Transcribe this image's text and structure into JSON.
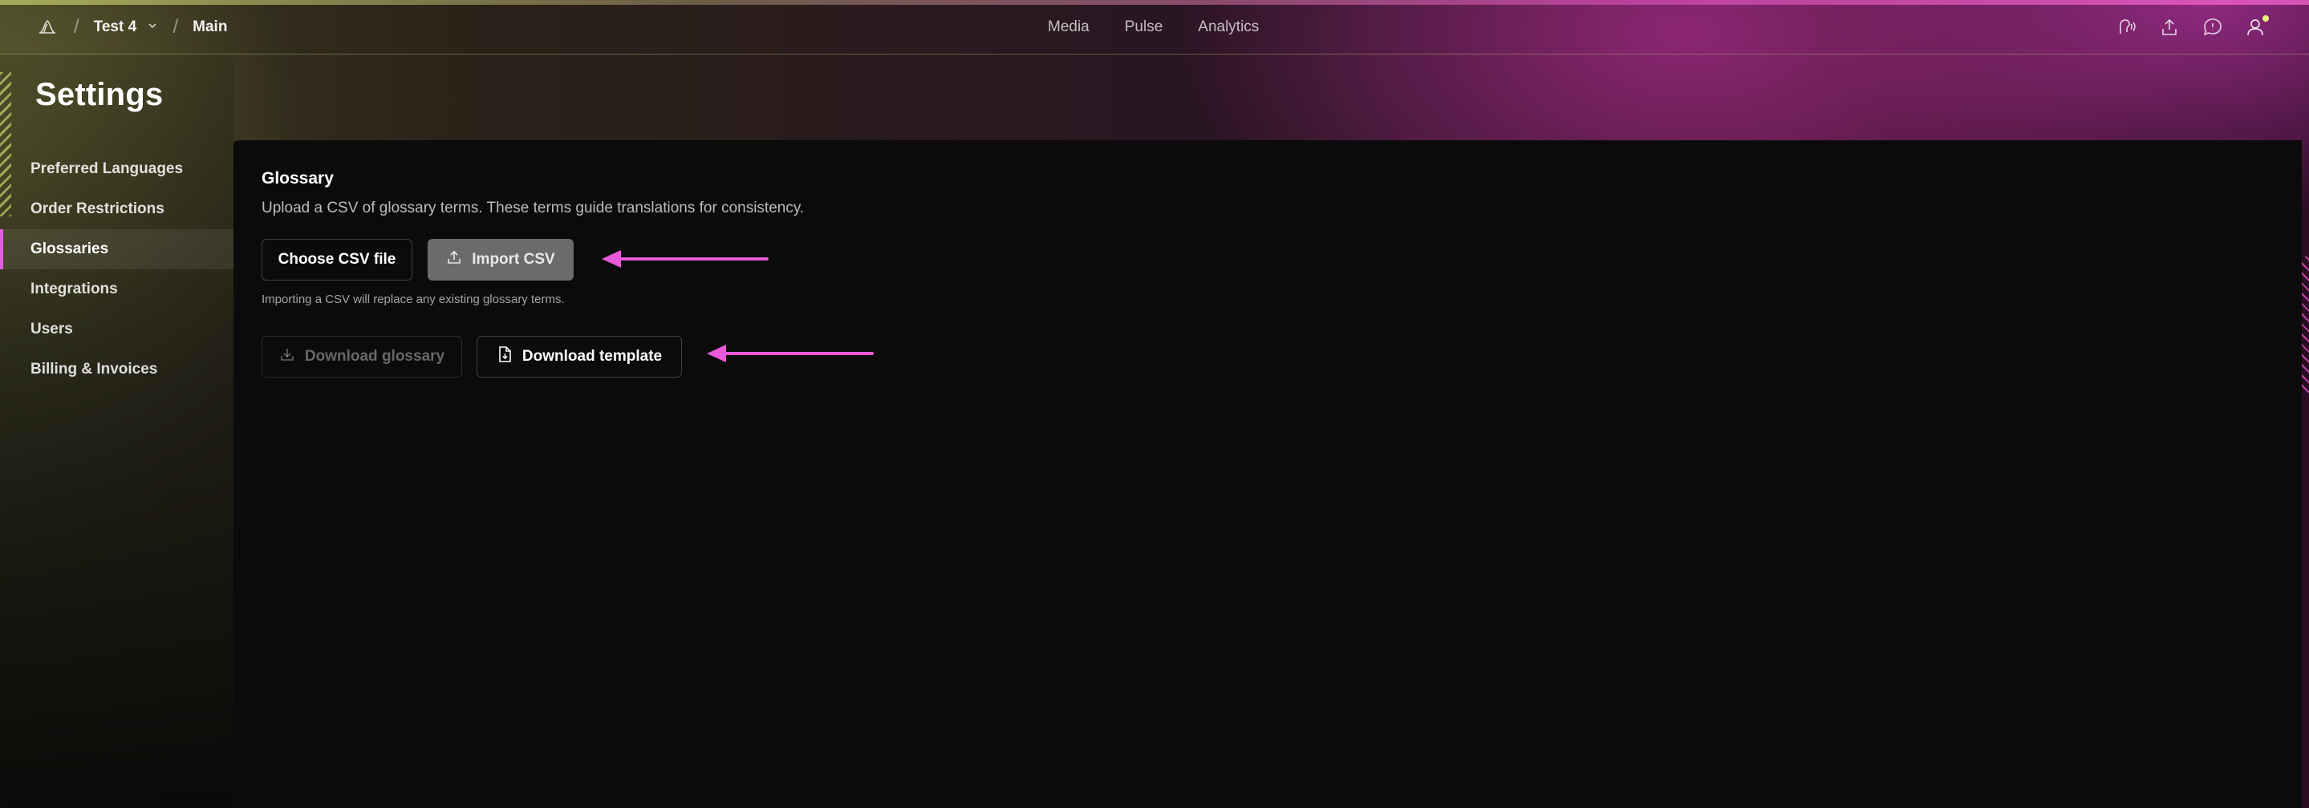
{
  "header": {
    "workspace": "Test 4",
    "project": "Main",
    "nav": [
      "Media",
      "Pulse",
      "Analytics"
    ]
  },
  "page": {
    "title": "Settings"
  },
  "sidebar": {
    "items": [
      {
        "label": "Preferred Languages"
      },
      {
        "label": "Order Restrictions"
      },
      {
        "label": "Glossaries"
      },
      {
        "label": "Integrations"
      },
      {
        "label": "Users"
      },
      {
        "label": "Billing & Invoices"
      }
    ],
    "active": "Glossaries"
  },
  "glossary": {
    "title": "Glossary",
    "description": "Upload a CSV of glossary terms. These terms guide translations for consistency.",
    "choose_label": "Choose CSV file",
    "import_label": "Import CSV",
    "note": "Importing a CSV will replace any existing glossary terms.",
    "download_glossary_label": "Download glossary",
    "download_template_label": "Download template"
  },
  "icons": {
    "logo": "bell-logo-icon",
    "upload": "upload-icon",
    "download": "download-icon",
    "file": "file-download-icon",
    "audio": "audio-icon",
    "share": "share-icon",
    "feedback": "message-alert-icon",
    "user": "user-icon"
  },
  "colors": {
    "accent": "#e05fe0",
    "annotation_arrow": "#e85ad8",
    "notification_dot": "#e9f27a"
  }
}
